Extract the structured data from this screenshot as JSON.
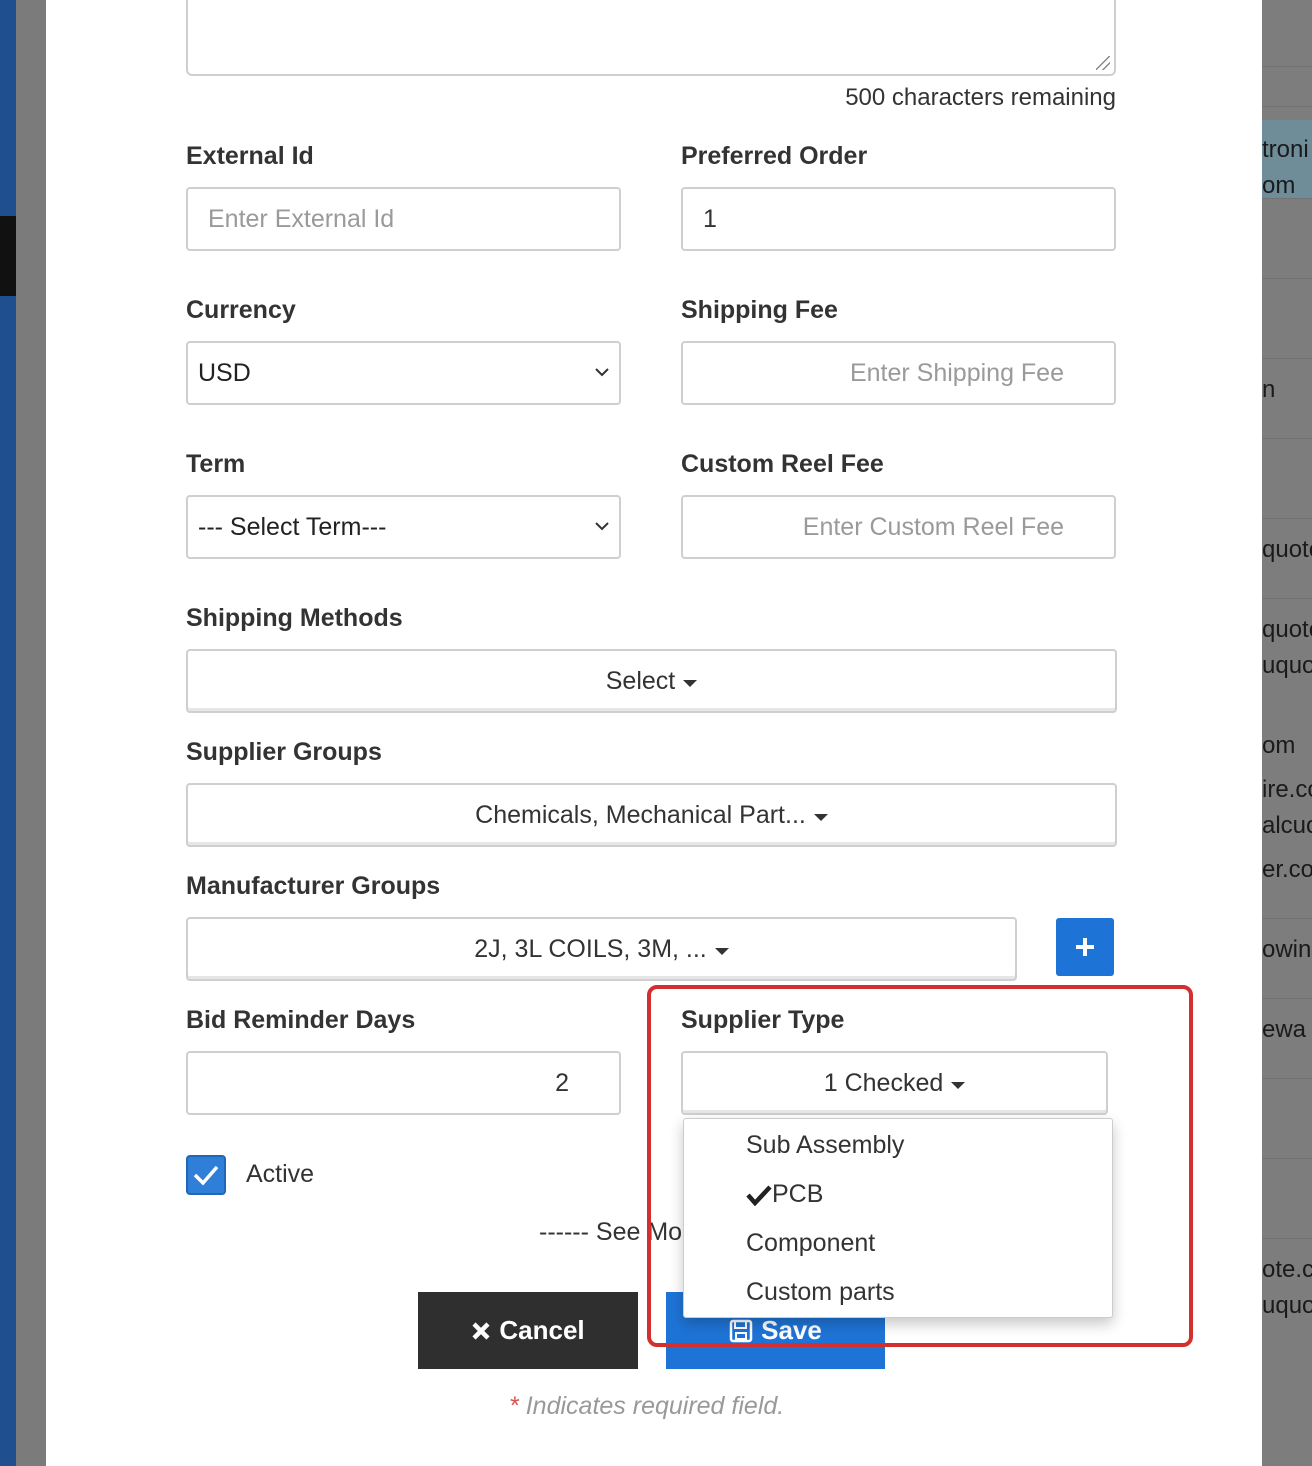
{
  "form": {
    "characters_remaining": "500 characters remaining",
    "external_id": {
      "label": "External Id",
      "placeholder": "Enter External Id",
      "value": ""
    },
    "preferred_order": {
      "label": "Preferred Order",
      "value": "1"
    },
    "currency": {
      "label": "Currency",
      "selected": "USD"
    },
    "shipping_fee": {
      "label": "Shipping Fee",
      "placeholder": "Enter Shipping Fee"
    },
    "term": {
      "label": "Term",
      "selected": "--- Select Term---"
    },
    "custom_reel_fee": {
      "label": "Custom Reel Fee",
      "placeholder": "Enter Custom Reel Fee"
    },
    "shipping_methods": {
      "label": "Shipping Methods",
      "button": "Select"
    },
    "supplier_groups": {
      "label": "Supplier Groups",
      "button": "Chemicals, Mechanical Part..."
    },
    "manufacturer_groups": {
      "label": "Manufacturer Groups",
      "button": "2J, 3L COILS, 3M, ...",
      "add_icon": "plus-icon"
    },
    "bid_reminder_days": {
      "label": "Bid Reminder Days",
      "value": "2"
    },
    "supplier_type": {
      "label": "Supplier Type",
      "button": "1 Checked",
      "options": [
        {
          "label": "Sub Assembly",
          "checked": false
        },
        {
          "label": "PCB",
          "checked": true
        },
        {
          "label": "Component",
          "checked": false
        },
        {
          "label": "Custom parts",
          "checked": false
        }
      ]
    },
    "active": {
      "label": "Active",
      "checked": true
    },
    "see_more": "------ See Mo",
    "cancel_label": "Cancel",
    "save_label": "Save",
    "required_star": "*",
    "required_note": "Indicates required field."
  },
  "background_fragments": [
    "troni",
    "om",
    "n",
    "quote",
    "quote",
    "uquo",
    "om",
    "ire.co",
    "alcuo",
    "er.co",
    "owin",
    "ewa",
    "ote.c",
    "uquo"
  ],
  "colors": {
    "primary": "#1e74d6",
    "cancel": "#2f2f2f",
    "highlight": "#d32f2f",
    "required": "#d9534f"
  }
}
